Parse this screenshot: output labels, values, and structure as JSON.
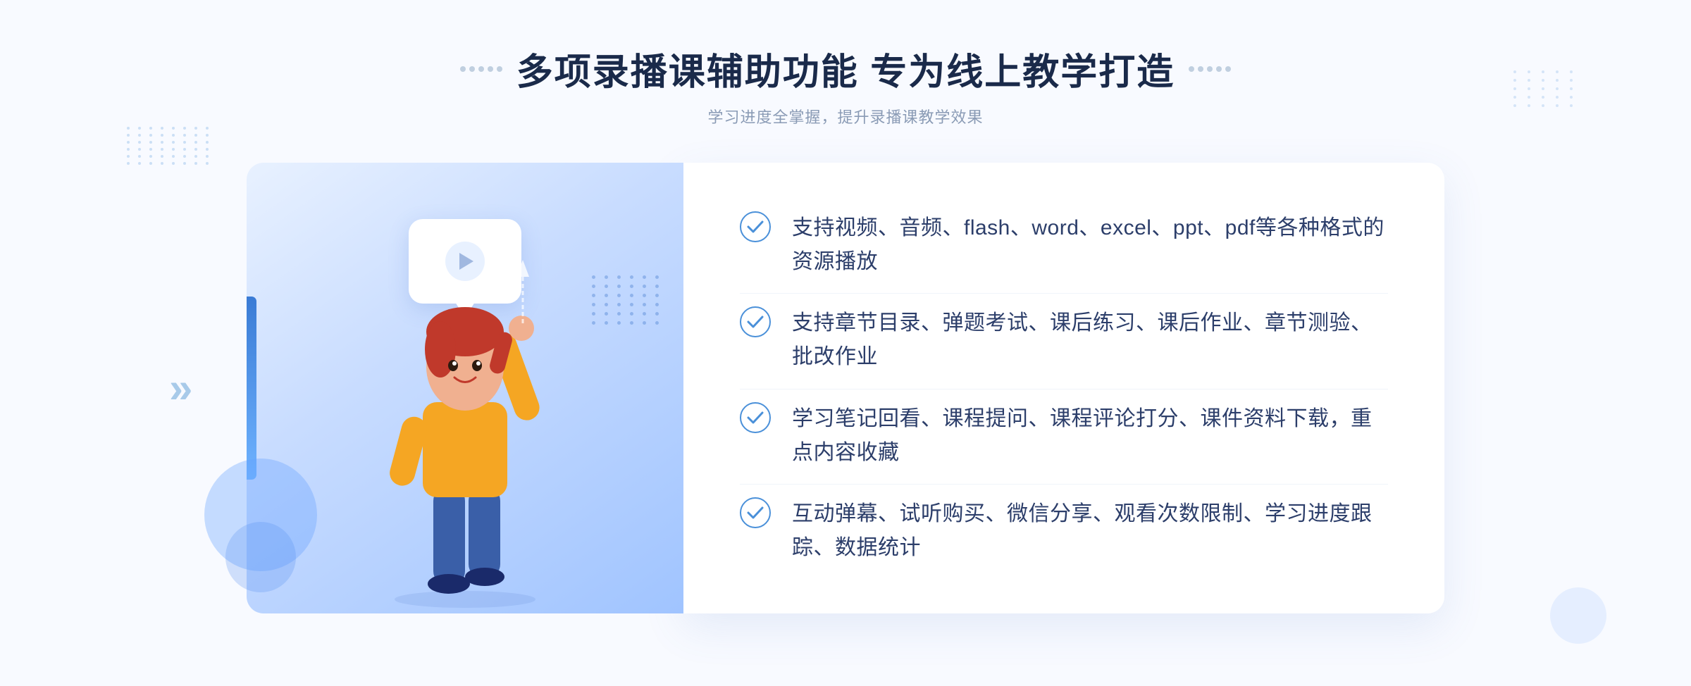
{
  "header": {
    "title": "多项录播课辅助功能 专为线上教学打造",
    "subtitle": "学习进度全掌握，提升录播课教学效果",
    "dots_decoration": true
  },
  "features": [
    {
      "id": 1,
      "text": "支持视频、音频、flash、word、excel、ppt、pdf等各种格式的资源播放"
    },
    {
      "id": 2,
      "text": "支持章节目录、弹题考试、课后练习、课后作业、章节测验、批改作业"
    },
    {
      "id": 3,
      "text": "学习笔记回看、课程提问、课程评论打分、课件资料下载，重点内容收藏"
    },
    {
      "id": 4,
      "text": "互动弹幕、试听购买、微信分享、观看次数限制、学习进度跟踪、数据统计"
    }
  ],
  "chevron": {
    "symbol": "»"
  },
  "colors": {
    "primary": "#4a90d9",
    "title": "#1a2a4a",
    "subtitle": "#8a9bb5",
    "feature_text": "#2c3e6a",
    "card_bg": "#ffffff",
    "illus_bg_start": "#e8f1ff",
    "illus_bg_end": "#a0c4ff"
  }
}
